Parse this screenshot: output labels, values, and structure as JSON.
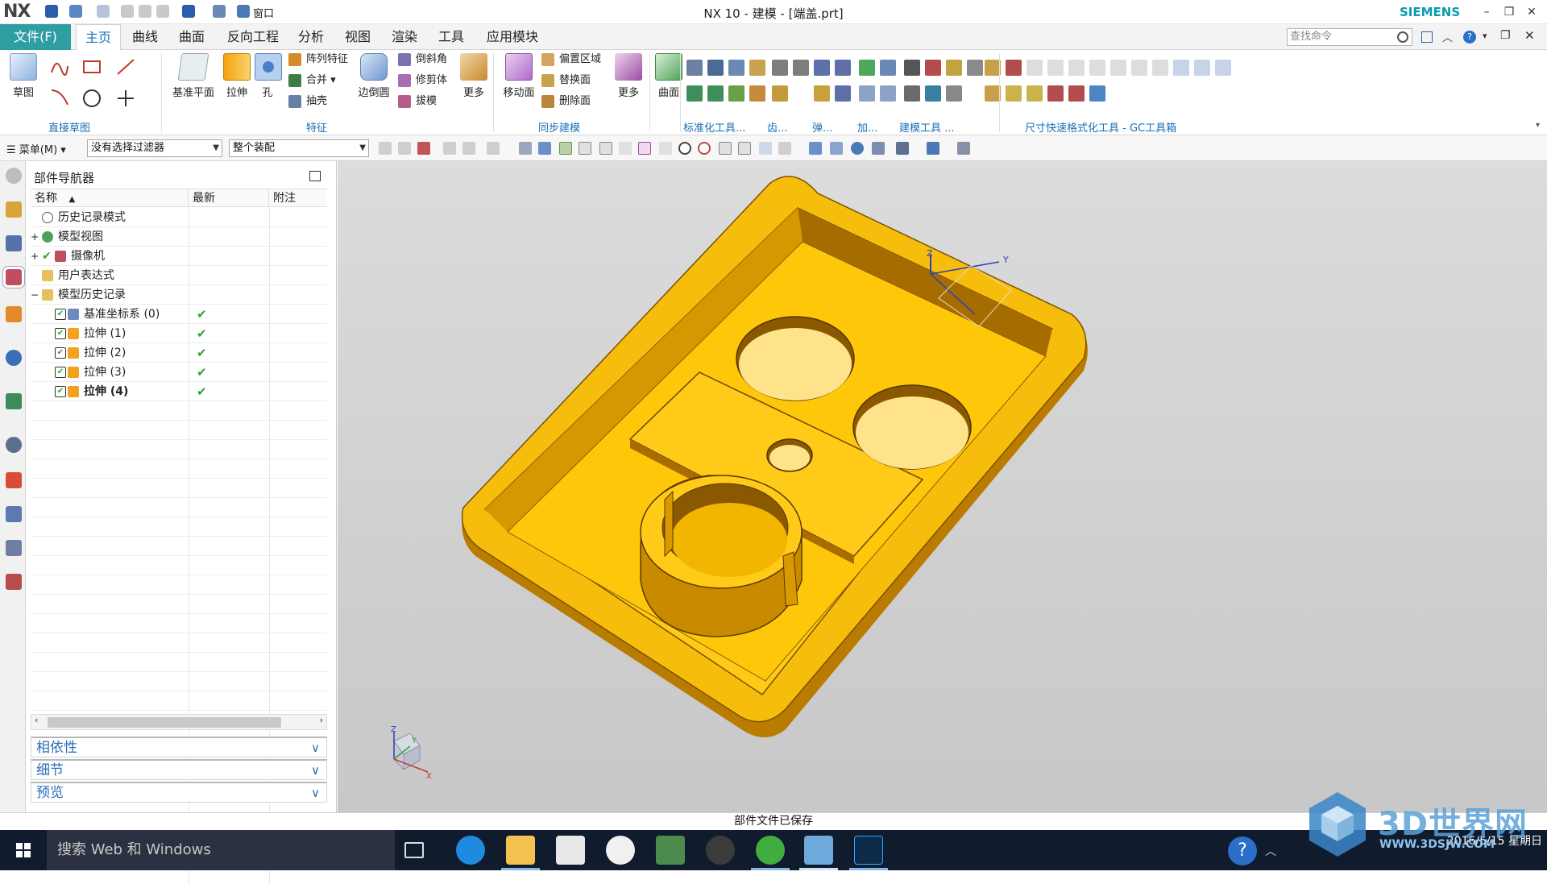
{
  "app": {
    "logo": "NX",
    "window_title": "NX 10 - 建模 - [端盖.prt]",
    "brand": "SIEMENS",
    "quick_window_menu": "窗口"
  },
  "menu": {
    "file": "文件(F)",
    "tabs": [
      "主页",
      "曲线",
      "曲面",
      "反向工程",
      "分析",
      "视图",
      "渲染",
      "工具",
      "应用模块"
    ],
    "active_tab": "主页",
    "search_placeholder": "查找命令"
  },
  "ribbon": {
    "direct_sketch": {
      "label": "直接草图",
      "sketch": "草图"
    },
    "feature": {
      "label": "特征",
      "datum_plane": "基准平面",
      "extrude": "拉伸",
      "hole": "孔",
      "pattern": "阵列特征",
      "unite": "合并",
      "shell": "抽壳",
      "edge_blend": "边倒圆",
      "chamfer": "倒斜角",
      "trim_body": "修剪体",
      "draft": "拔模",
      "more": "更多"
    },
    "sync": {
      "label": "同步建模",
      "move_face": "移动面",
      "offset_region": "偏置区域",
      "replace_face": "替换面",
      "delete_face": "删除面",
      "more": "更多"
    },
    "surface": {
      "label": "曲面"
    },
    "groups_right": [
      "标准化工具...",
      "齿...",
      "弹...",
      "加...",
      "建模工具 ...",
      "尺寸快速格式化工具 - GC工具箱"
    ]
  },
  "toolbar2": {
    "menu": "菜单(M)",
    "filter": "没有选择过滤器",
    "scope": "整个装配"
  },
  "navigator": {
    "title": "部件导航器",
    "columns": [
      "名称",
      "最新",
      "附注"
    ],
    "rows": [
      {
        "label": "历史记录模式",
        "latest": ""
      },
      {
        "label": "模型视图",
        "latest": ""
      },
      {
        "label": "摄像机",
        "latest": ""
      },
      {
        "label": "用户表达式",
        "latest": ""
      },
      {
        "label": "模型历史记录",
        "latest": ""
      },
      {
        "label": "基准坐标系 (0)",
        "latest": "✔"
      },
      {
        "label": "拉伸 (1)",
        "latest": "✔"
      },
      {
        "label": "拉伸 (2)",
        "latest": "✔"
      },
      {
        "label": "拉伸 (3)",
        "latest": "✔"
      },
      {
        "label": "拉伸 (4)",
        "latest": "✔"
      }
    ],
    "panels": [
      "相依性",
      "细节",
      "预览"
    ]
  },
  "viewport": {
    "triad_labels": [
      "Z",
      "Y",
      "X"
    ],
    "model_color": "#f6b800"
  },
  "status": {
    "message": "部件文件已保存"
  },
  "taskbar": {
    "search": "搜索 Web 和 Windows",
    "time": "",
    "date": "2016/5/15 星期日"
  },
  "watermark": {
    "main": "3D世界网",
    "sub": "WWW.3DSJW.COM"
  }
}
